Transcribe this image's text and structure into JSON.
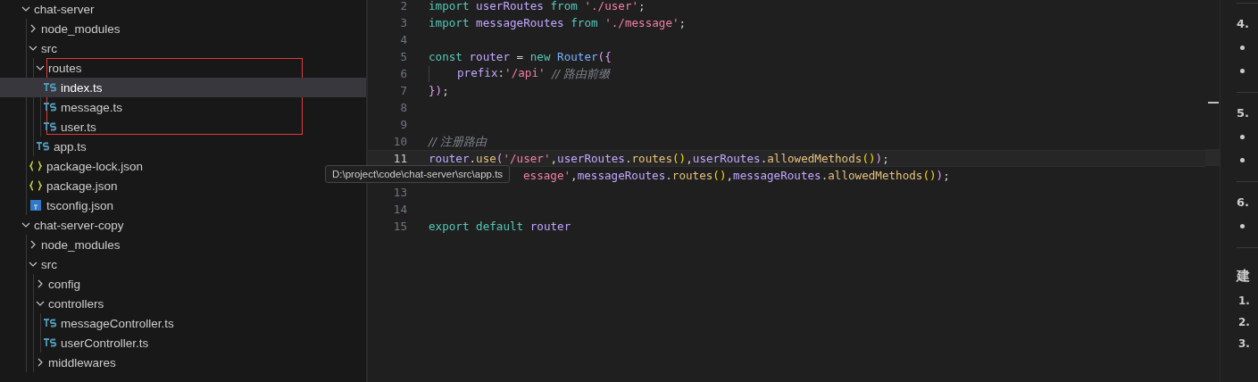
{
  "explorer": {
    "items": [
      {
        "label": "chat-server",
        "kind": "folder",
        "expanded": true,
        "selected": false,
        "children": [
          {
            "label": "node_modules",
            "kind": "folder",
            "expanded": false,
            "selected": false
          },
          {
            "label": "src",
            "kind": "folder",
            "expanded": true,
            "selected": false,
            "children": [
              {
                "label": "routes",
                "kind": "folder",
                "expanded": true,
                "selected": false,
                "outlined": true,
                "children": [
                  {
                    "label": "index.ts",
                    "kind": "ts",
                    "selected": true
                  },
                  {
                    "label": "message.ts",
                    "kind": "ts",
                    "selected": false
                  },
                  {
                    "label": "user.ts",
                    "kind": "ts",
                    "selected": false
                  }
                ]
              },
              {
                "label": "app.ts",
                "kind": "ts",
                "selected": false
              }
            ]
          },
          {
            "label": "package-lock.json",
            "kind": "json",
            "selected": false
          },
          {
            "label": "package.json",
            "kind": "json",
            "selected": false
          },
          {
            "label": "tsconfig.json",
            "kind": "tsconfig",
            "selected": false
          }
        ]
      },
      {
        "label": "chat-server-copy",
        "kind": "folder",
        "expanded": true,
        "selected": false,
        "children": [
          {
            "label": "node_modules",
            "kind": "folder",
            "expanded": false,
            "selected": false
          },
          {
            "label": "src",
            "kind": "folder",
            "expanded": true,
            "selected": false,
            "children": [
              {
                "label": "config",
                "kind": "folder",
                "expanded": false,
                "selected": false
              },
              {
                "label": "controllers",
                "kind": "folder",
                "expanded": true,
                "selected": false,
                "children": [
                  {
                    "label": "messageController.ts",
                    "kind": "ts",
                    "selected": false
                  },
                  {
                    "label": "userController.ts",
                    "kind": "ts",
                    "selected": false
                  }
                ]
              },
              {
                "label": "middlewares",
                "kind": "folder",
                "expanded": false,
                "selected": false
              }
            ]
          }
        ]
      }
    ]
  },
  "tooltip": {
    "text": "D:\\project\\code\\chat-server\\src\\app.ts"
  },
  "editor": {
    "lines": [
      {
        "number": "2",
        "current": false,
        "tokens": [
          {
            "kind": "keyword",
            "text": "import "
          },
          {
            "kind": "ident",
            "text": "userRoutes "
          },
          {
            "kind": "keyword",
            "text": "from "
          },
          {
            "kind": "string",
            "text": "'./user'"
          },
          {
            "kind": "punct",
            "text": ";"
          }
        ]
      },
      {
        "number": "3",
        "current": false,
        "tokens": [
          {
            "kind": "keyword",
            "text": "import "
          },
          {
            "kind": "ident",
            "text": "messageRoutes "
          },
          {
            "kind": "keyword",
            "text": "from "
          },
          {
            "kind": "string",
            "text": "'./message'"
          },
          {
            "kind": "punct",
            "text": ";"
          }
        ]
      },
      {
        "number": "4",
        "current": false
      },
      {
        "number": "5",
        "current": false,
        "tokens": [
          {
            "kind": "keyword",
            "text": "const "
          },
          {
            "kind": "ident",
            "text": "router "
          },
          {
            "kind": "punct",
            "text": "= "
          },
          {
            "kind": "keyword",
            "text": "new "
          },
          {
            "kind": "type",
            "text": "Router"
          },
          {
            "kind": "bracket",
            "text": "({"
          }
        ]
      },
      {
        "number": "6",
        "current": false,
        "indent_guide": true,
        "tokens": [
          {
            "kind": "ident",
            "text": "prefix"
          },
          {
            "kind": "punct",
            "text": ":"
          },
          {
            "kind": "string",
            "text": "'/api' "
          },
          {
            "kind": "comment",
            "text": "// 路由前缀"
          }
        ]
      },
      {
        "number": "7",
        "current": false,
        "tokens": [
          {
            "kind": "bracket",
            "text": "})"
          },
          {
            "kind": "punct",
            "text": ";"
          }
        ]
      },
      {
        "number": "8",
        "current": false
      },
      {
        "number": "9",
        "current": false
      },
      {
        "number": "10",
        "current": false,
        "tokens": [
          {
            "kind": "comment",
            "text": "// 注册路由"
          }
        ]
      },
      {
        "number": "11",
        "current": true,
        "tokens": [
          {
            "kind": "ident",
            "text": "router"
          },
          {
            "kind": "punct",
            "text": "."
          },
          {
            "kind": "method",
            "text": "use"
          },
          {
            "kind": "bracket",
            "text": "("
          },
          {
            "kind": "string",
            "text": "'/user'"
          },
          {
            "kind": "punct",
            "text": ","
          },
          {
            "kind": "ident",
            "text": "userRoutes"
          },
          {
            "kind": "punct",
            "text": "."
          },
          {
            "kind": "method",
            "text": "routes"
          },
          {
            "kind": "paren",
            "text": "()"
          },
          {
            "kind": "punct",
            "text": ","
          },
          {
            "kind": "ident",
            "text": "userRoutes"
          },
          {
            "kind": "punct",
            "text": "."
          },
          {
            "kind": "method",
            "text": "allowedMethods"
          },
          {
            "kind": "paren",
            "text": "()"
          },
          {
            "kind": "bracket",
            "text": ")"
          },
          {
            "kind": "punct",
            "text": ";"
          }
        ]
      },
      {
        "current": false,
        "tokens": [
          {
            "kind": "string",
            "text": "essage'"
          },
          {
            "kind": "punct",
            "text": ","
          },
          {
            "kind": "ident",
            "text": "messageRoutes"
          },
          {
            "kind": "punct",
            "text": "."
          },
          {
            "kind": "method",
            "text": "routes"
          },
          {
            "kind": "paren",
            "text": "()"
          },
          {
            "kind": "punct",
            "text": ","
          },
          {
            "kind": "ident",
            "text": "messageRoutes"
          },
          {
            "kind": "punct",
            "text": "."
          },
          {
            "kind": "method",
            "text": "allowedMethods"
          },
          {
            "kind": "paren",
            "text": "()"
          },
          {
            "kind": "bracket",
            "text": ")"
          },
          {
            "kind": "punct",
            "text": ";"
          }
        ]
      },
      {
        "number": "13",
        "current": false
      },
      {
        "number": "14",
        "current": false
      },
      {
        "number": "15",
        "current": false,
        "tokens": [
          {
            "kind": "keyword",
            "text": "export "
          },
          {
            "kind": "keyword",
            "text": "default "
          },
          {
            "kind": "ident",
            "text": "router"
          }
        ]
      }
    ]
  },
  "preview": {
    "blocks": [
      {
        "kind": "rule"
      },
      {
        "kind": "heading",
        "text": "4."
      },
      {
        "kind": "bullet"
      },
      {
        "kind": "bullet"
      },
      {
        "kind": "rule"
      },
      {
        "kind": "heading",
        "text": "5."
      },
      {
        "kind": "bullet"
      },
      {
        "kind": "bullet"
      },
      {
        "kind": "rule"
      },
      {
        "kind": "heading",
        "text": "6."
      },
      {
        "kind": "bullet"
      },
      {
        "kind": "rule"
      },
      {
        "kind": "title",
        "text": "建"
      },
      {
        "kind": "numbered",
        "text": "1."
      },
      {
        "kind": "numbered",
        "text": "2."
      },
      {
        "kind": "numbered",
        "text": "3."
      }
    ]
  }
}
